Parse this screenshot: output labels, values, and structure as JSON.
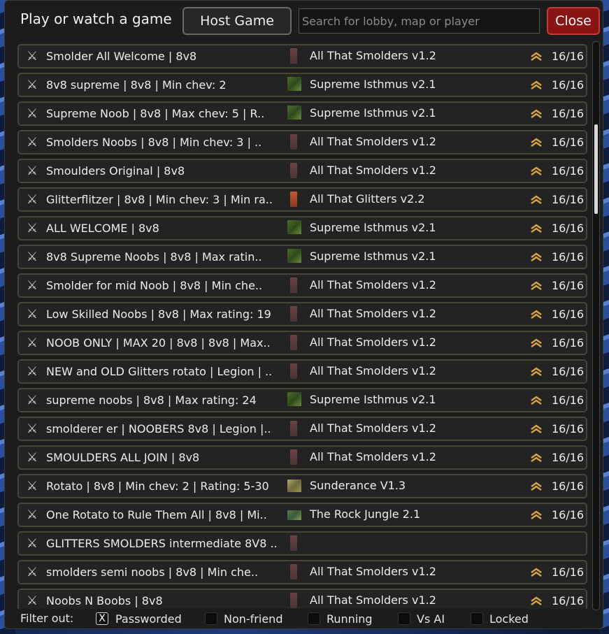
{
  "header": {
    "title": "Play or watch a game",
    "host_label": "Host Game",
    "search_placeholder": "Search for lobby, map or player",
    "close_label": "Close"
  },
  "lobbies": [
    {
      "name": "Smolder All Welcome | 8v8",
      "map": "All That Smolders v1.2",
      "map_type": "smolders",
      "players": "16/16"
    },
    {
      "name": "8v8 supreme | 8v8 | Min chev: 2",
      "map": "Supreme Isthmus v2.1",
      "map_type": "isthmus",
      "players": "16/16"
    },
    {
      "name": "Supreme Noob | 8v8 | Max chev: 5 | R..",
      "map": "Supreme Isthmus v2.1",
      "map_type": "isthmus",
      "players": "16/16"
    },
    {
      "name": "Smolders Noobs | 8v8 | Min chev: 3 | ..",
      "map": "All That Smolders v1.2",
      "map_type": "smolders",
      "players": "16/16"
    },
    {
      "name": "Smoulders Original | 8v8",
      "map": "All That Smolders v1.2",
      "map_type": "smolders",
      "players": "16/16"
    },
    {
      "name": "Glitterflitzer | 8v8 | Min chev: 3 | Min ra..",
      "map": "All That Glitters v2.2",
      "map_type": "glitters",
      "players": "16/16"
    },
    {
      "name": "ALL WELCOME | 8v8",
      "map": "Supreme Isthmus v2.1",
      "map_type": "isthmus",
      "players": "16/16"
    },
    {
      "name": "8v8 Supreme Noobs | 8v8 | Max ratin..",
      "map": "Supreme Isthmus v2.1",
      "map_type": "isthmus",
      "players": "16/16"
    },
    {
      "name": "Smolder for mid Noob | 8v8 | Min che..",
      "map": "All That Smolders v1.2",
      "map_type": "smolders",
      "players": "16/16"
    },
    {
      "name": "Low Skilled Noobs | 8v8 | Max rating: 19",
      "map": "All That Smolders v1.2",
      "map_type": "smolders",
      "players": "16/16"
    },
    {
      "name": "NOOB ONLY | MAX 20 | 8v8 | 8v8 | Max..",
      "map": "All That Smolders v1.2",
      "map_type": "smolders",
      "players": "16/16"
    },
    {
      "name": "NEW and OLD Glitters rotato | Legion | ..",
      "map": "All That Smolders v1.2",
      "map_type": "smolders",
      "players": "16/16"
    },
    {
      "name": "supreme noobs | 8v8 | Max rating: 24",
      "map": "Supreme Isthmus v2.1",
      "map_type": "isthmus",
      "players": "16/16"
    },
    {
      "name": "smolderer er | NOOBERS 8v8 | Legion |..",
      "map": "All That Smolders v1.2",
      "map_type": "smolders",
      "players": "16/16"
    },
    {
      "name": "SMOULDERS ALL JOIN | 8v8",
      "map": "All That Smolders v1.2",
      "map_type": "smolders",
      "players": "16/16"
    },
    {
      "name": "Rotato | 8v8 | Min chev: 2 | Rating: 5-30",
      "map": "Sunderance V1.3",
      "map_type": "sunder",
      "players": "16/16"
    },
    {
      "name": "One Rotato to Rule Them All | 8v8 | Mi..",
      "map": "The Rock Jungle 2.1",
      "map_type": "jungle",
      "players": "16/16"
    },
    {
      "name": "GLITTERS SMOLDERS intermediate 8V8 ..",
      "map": "",
      "map_type": "smolders",
      "players": ""
    },
    {
      "name": "smolders semi noobs | 8v8 | Min che..",
      "map": "All That Smolders v1.2",
      "map_type": "smolders",
      "players": "16/16"
    },
    {
      "name": "Noobs N Boobs | 8v8",
      "map": "All That Smolders v1.2",
      "map_type": "smolders",
      "players": "16/16"
    }
  ],
  "filters": {
    "label": "Filter out:",
    "options": [
      {
        "label": "Passworded",
        "checked": true
      },
      {
        "label": "Non-friend",
        "checked": false
      },
      {
        "label": "Running",
        "checked": false
      },
      {
        "label": "Vs AI",
        "checked": false
      },
      {
        "label": "Locked",
        "checked": false
      }
    ]
  },
  "colors": {
    "accent_close": "#8a1414",
    "rank_gold": "#d9a441"
  }
}
